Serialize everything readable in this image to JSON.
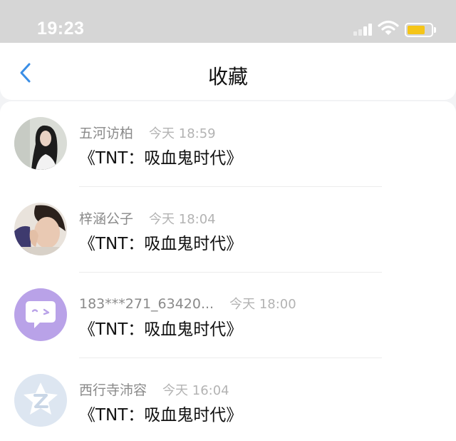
{
  "status_bar": {
    "time": "19:23",
    "battery_level": 0.75,
    "battery_color": "#f5c518",
    "signal_icon": "signal-bars-icon",
    "wifi_icon": "wifi-icon"
  },
  "header": {
    "title": "收藏",
    "back_icon": "chevron-left-icon",
    "accent_color": "#3a8ee6"
  },
  "favorites": [
    {
      "sender": "五河访柏",
      "time": "今天 18:59",
      "title": "《TNT：吸血鬼时代》",
      "avatar": "photo-girl-long-hair"
    },
    {
      "sender": "梓涵公子",
      "time": "今天 18:04",
      "title": "《TNT：吸血鬼时代》",
      "avatar": "photo-selfie"
    },
    {
      "sender": "183***271_63420...",
      "time": "今天 18:00",
      "title": "《TNT：吸血鬼时代》",
      "avatar": "purple-chat-bubble-icon"
    },
    {
      "sender": "西行寺沛容",
      "time": "今天 16:04",
      "title": "《TNT：吸血鬼时代》",
      "avatar": "default-z-logo-icon"
    }
  ]
}
